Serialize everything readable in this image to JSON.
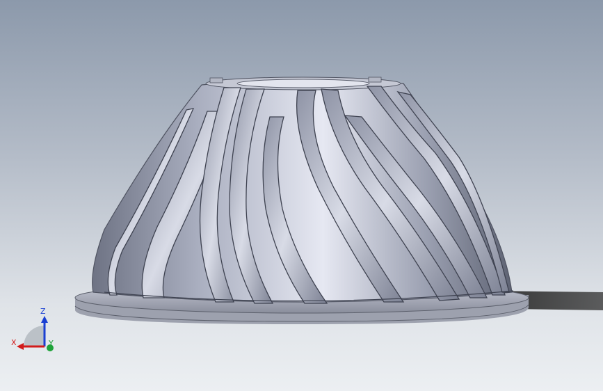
{
  "viewport": {
    "background_top": "#8c99ab",
    "background_bottom": "#eceff2"
  },
  "model": {
    "description_icon": "impeller-3d-model",
    "body_color": "#b8bccb",
    "blade_count": 12
  },
  "triad": {
    "x_label": "X",
    "y_label": "Y",
    "z_label": "Z",
    "x_color": "#d21a1a",
    "y_color": "#1fa33a",
    "z_color": "#1a3fd2"
  }
}
